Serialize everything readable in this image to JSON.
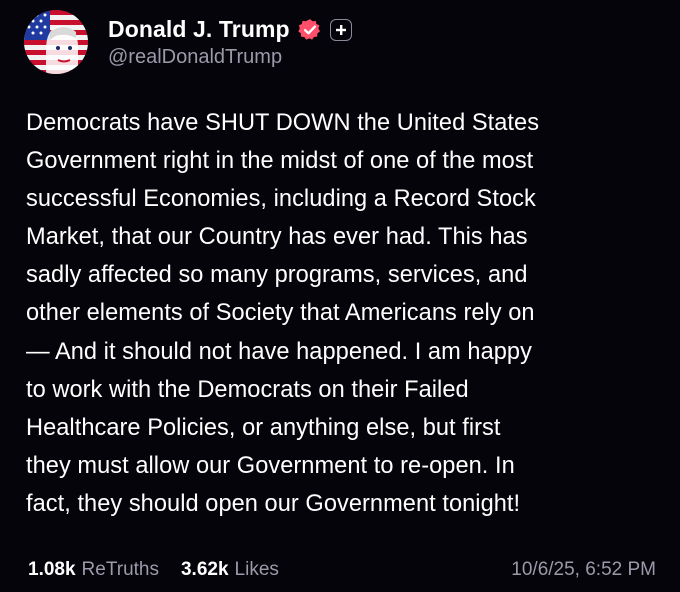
{
  "post": {
    "author": {
      "display_name": "Donald J. Trump",
      "handle": "@realDonaldTrump",
      "verified_icon": "verified-badge-icon",
      "follow_icon": "plus-icon",
      "avatar_icon": "profile-avatar"
    },
    "body_lines": [
      "Democrats have SHUT DOWN the United States",
      "Government right in the midst of one of the most",
      "successful Economies, including a Record Stock",
      "Market, that our Country has ever had. This has",
      "sadly affected so many programs, services, and",
      "other elements of Society that Americans rely on",
      "— And it should not have happened. I am happy",
      "to work with the Democrats on their Failed",
      "Healthcare Policies, or anything else, but first",
      "they must allow our Government to re-open. In",
      "fact, they should open our Government tonight!"
    ],
    "stats": {
      "retruths_count": "1.08k",
      "retruths_label": "ReTruths",
      "likes_count": "3.62k",
      "likes_label": "Likes"
    },
    "timestamp": "10/6/25, 6:52 PM"
  },
  "colors": {
    "background": "#05040a",
    "text": "#ffffff",
    "muted": "#9a9aaa",
    "verified_badge": "#ff4f6a"
  }
}
